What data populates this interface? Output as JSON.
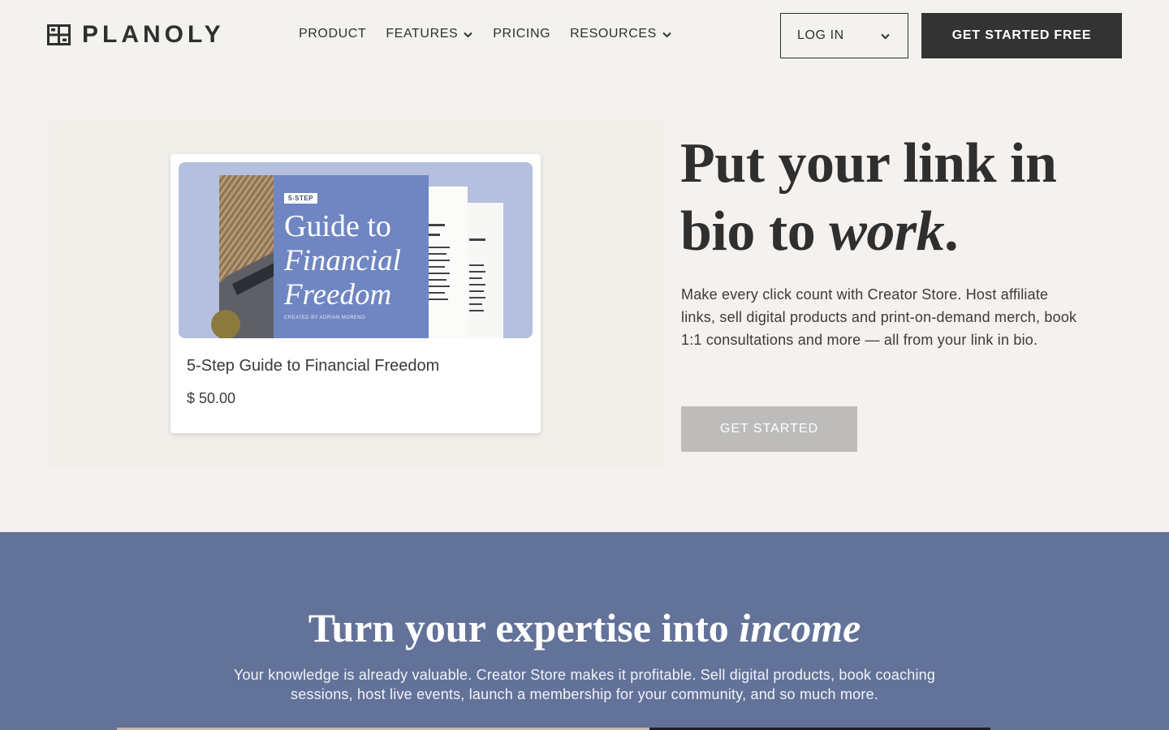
{
  "brand": {
    "name": "PLANOLY"
  },
  "nav": {
    "items": [
      {
        "label": "PRODUCT",
        "has_dropdown": false
      },
      {
        "label": "FEATURES",
        "has_dropdown": true
      },
      {
        "label": "PRICING",
        "has_dropdown": false
      },
      {
        "label": "RESOURCES",
        "has_dropdown": true
      }
    ],
    "login_label": "LOG IN",
    "cta_label": "GET STARTED FREE"
  },
  "hero": {
    "title_part1": "Put your link in bio to ",
    "title_emphasis": "work",
    "title_end": ".",
    "description": "Make every click count with Creator Store. Host affiliate links, sell digital products and print-on-demand merch, book 1:1 consultations and more — all from your link in bio.",
    "cta_label": "GET STARTED",
    "product_card": {
      "cover_tag": "5-STEP",
      "cover_line1": "Guide to",
      "cover_line2": "Financial",
      "cover_line3": "Freedom",
      "cover_credit": "CREATED BY ADRIAN MORENO",
      "title": "5-Step Guide to Financial Freedom",
      "price": "$ 50.00"
    }
  },
  "section2": {
    "title_part1": "Turn your expertise into ",
    "title_emphasis": "income",
    "description": "Your knowledge is already valuable. Creator Store makes it profitable. Sell digital products, book coaching sessions, host live events, launch a membership for your community, and so much more."
  },
  "colors": {
    "background": "#f4f1ee",
    "header": "#f3f2ee",
    "dark": "#333333",
    "accent_blue": "#627299",
    "cover_blue": "#6f86c2",
    "disabled_button": "#bdbcba"
  }
}
